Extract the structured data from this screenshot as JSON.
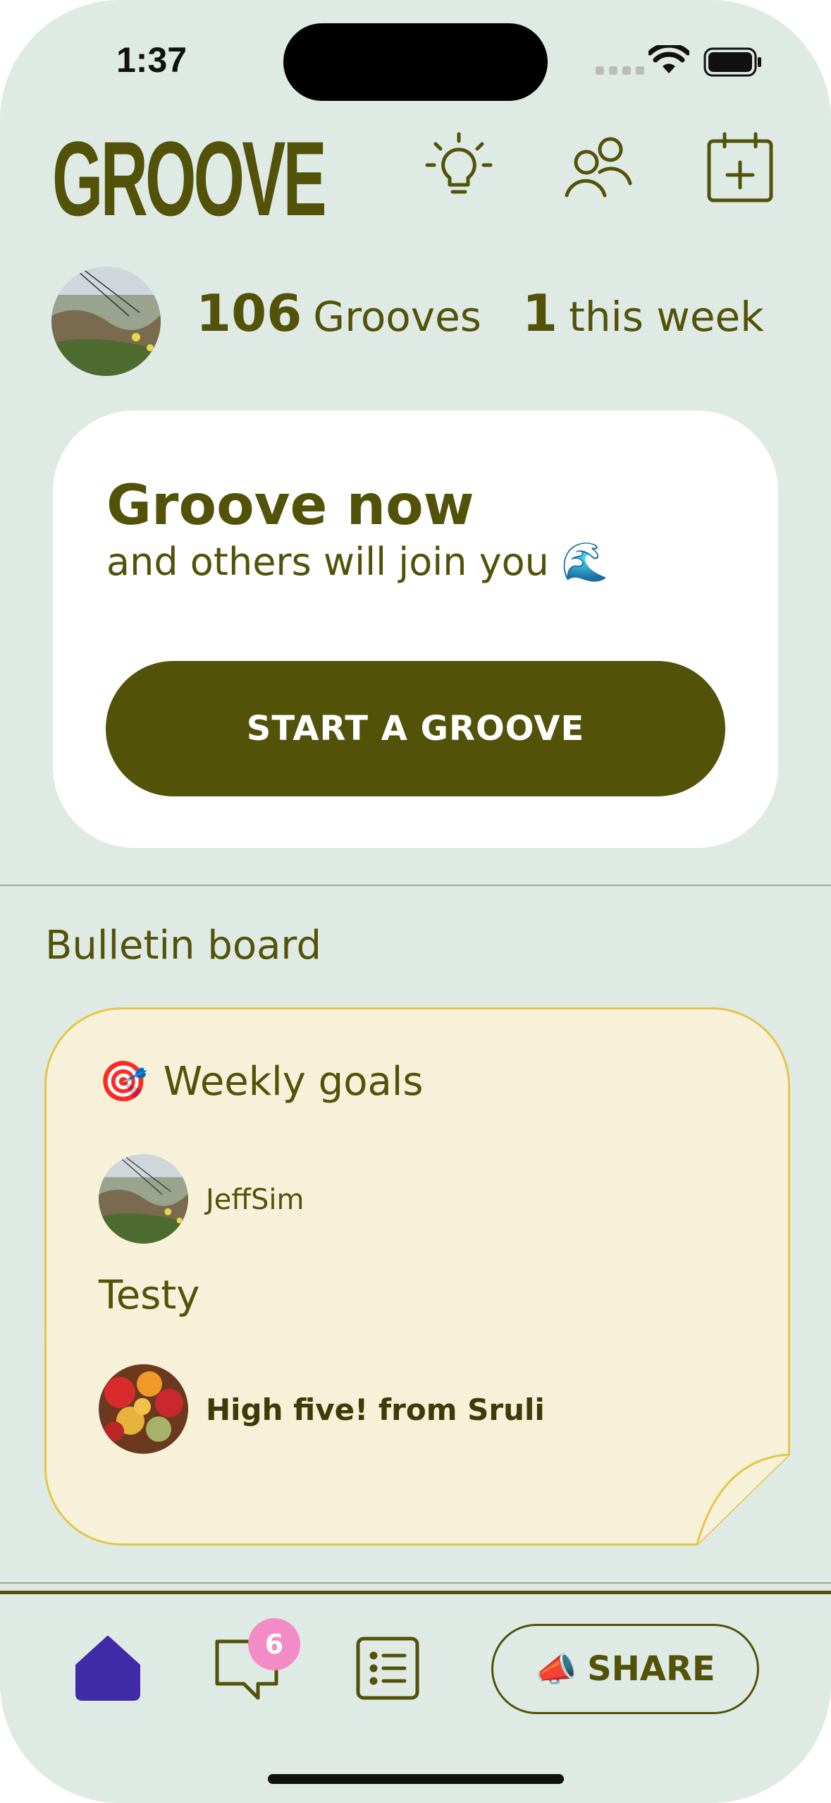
{
  "status_bar": {
    "time": "1:37"
  },
  "header": {
    "logo": "GROOVE",
    "icons": [
      "lightbulb-icon",
      "people-icon",
      "calendar-add-icon"
    ]
  },
  "stats": {
    "grooves_count": "106",
    "grooves_label": "Grooves",
    "week_count": "1",
    "week_label": "this week"
  },
  "groove_card": {
    "title": "Groove now",
    "subtitle": "and others will join you 🌊",
    "button_label": "START A GROOVE"
  },
  "bulletin": {
    "section_title": "Bulletin board",
    "note_title_emoji": "🎯",
    "note_title": "Weekly goals",
    "username": "JeffSim",
    "message": "Testy",
    "high_five": "High five! from Sruli"
  },
  "tabbar": {
    "chat_badge": "6",
    "share_emoji": "📣",
    "share_label": "SHARE"
  },
  "colors": {
    "background": "#dfeae4",
    "olive": "#525209",
    "note_fill": "#f7f1d9",
    "note_border": "#e2c64a",
    "home_active": "#3f2aa8",
    "badge": "#f38cc6"
  }
}
